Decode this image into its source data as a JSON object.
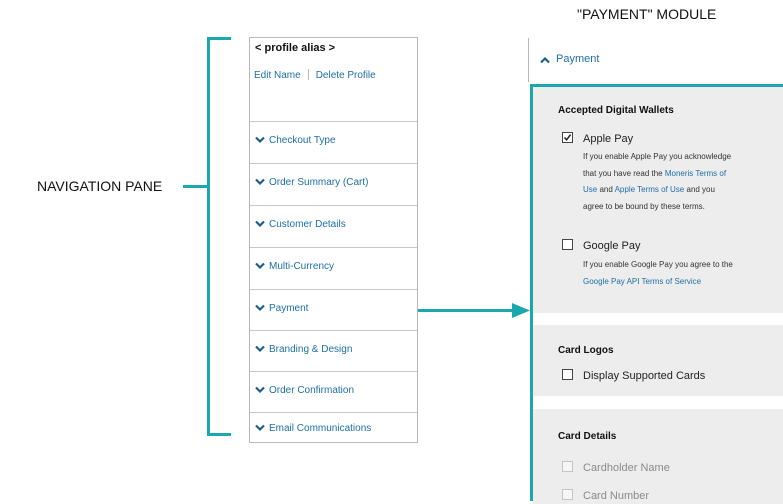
{
  "labels": {
    "navigation_pane": "NAVIGATION PANE",
    "payment_module": "\"PAYMENT\" MODULE"
  },
  "nav_pane": {
    "profile_alias": "< profile alias >",
    "edit_name": "Edit Name",
    "delete_profile": "Delete Profile",
    "items": [
      {
        "label": "Checkout Type"
      },
      {
        "label": "Order Summary (Cart)"
      },
      {
        "label": "Customer Details"
      },
      {
        "label": "Multi-Currency"
      },
      {
        "label": "Payment"
      },
      {
        "label": "Branding & Design"
      },
      {
        "label": "Order Confirmation"
      },
      {
        "label": "Email Communications"
      }
    ]
  },
  "payment": {
    "header": "Payment",
    "wallets": {
      "title": "Accepted Digital Wallets",
      "apple_pay": {
        "label": "Apple Pay",
        "checked": true,
        "desc_line1": "If you enable Apple Pay you acknowledge",
        "desc_line2_pre": "that you have read the ",
        "desc_line2_link": "Moneris Terms of",
        "desc_line3_link_a": "Use",
        "desc_line3_mid": " and ",
        "desc_line3_link_b": "Apple Terms of Use",
        "desc_line3_post": " and you",
        "desc_line4": "agree to be bound by these terms."
      },
      "google_pay": {
        "label": "Google Pay",
        "checked": false,
        "desc_line1": "If you enable Google Pay you agree to the",
        "desc_line2_link": "Google Pay API Terms of Service"
      }
    },
    "card_logos": {
      "title": "Card Logos",
      "display_supported": "Display Supported Cards"
    },
    "card_details": {
      "title": "Card Details",
      "cardholder_name": "Cardholder Name",
      "card_number": "Card Number"
    }
  },
  "colors": {
    "accent": "#1aa7ad",
    "link": "#1d6fa6",
    "section_bg": "#ededed"
  }
}
